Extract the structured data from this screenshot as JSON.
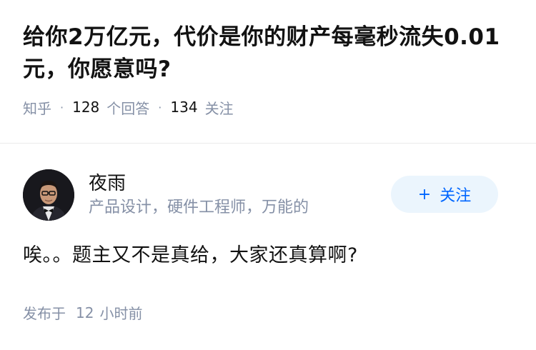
{
  "question": {
    "title": "给你2万亿元，代价是你的财产每毫秒流失0.01元，你愿意吗?",
    "source": "知乎",
    "answer_count": "128",
    "answer_label": "个回答",
    "follower_count": "134",
    "follower_label": "关注"
  },
  "answer": {
    "author_name": "夜雨",
    "author_bio": "产品设计，硬件工程师，万能的",
    "follow_button": {
      "plus": "+",
      "label": "关注"
    },
    "content": "唉。。题主又不是真给，大家还真算啊?",
    "publish_label": "发布于",
    "publish_num": "12",
    "publish_unit": "小时前"
  },
  "colors": {
    "accent": "#0066ff",
    "follow_bg": "#ebf5fd",
    "meta_gray": "#8590a6",
    "text": "#121212",
    "divider": "#ebebeb"
  }
}
